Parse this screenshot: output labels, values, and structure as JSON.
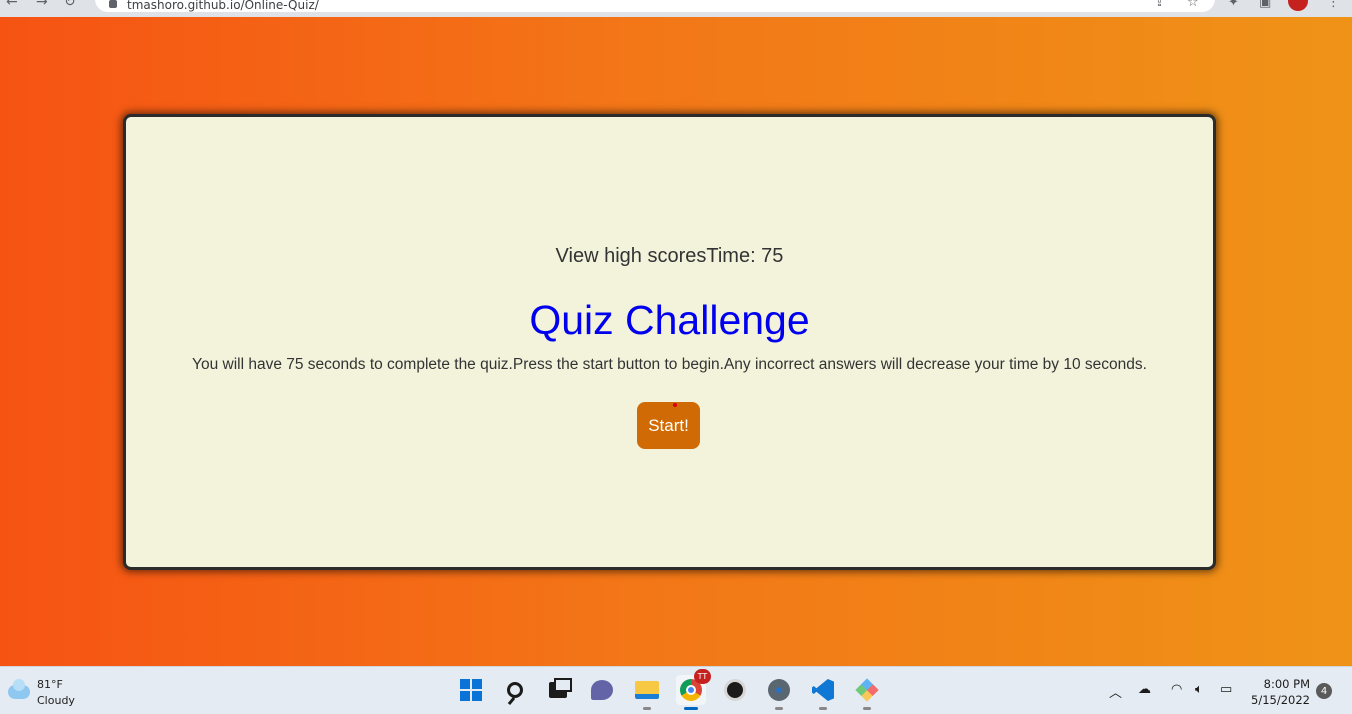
{
  "browser": {
    "url": "tmashoro.github.io/Online-Quiz/"
  },
  "page": {
    "header_text": "View high scoresTime: 75",
    "title": "Quiz Challenge",
    "instructions": "You will have 75 seconds to complete the quiz.Press the start button to begin.Any incorrect answers will decrease your time by 10 seconds.",
    "start_button_label": "Start!",
    "colors": {
      "background_gradient_start": "#f65313",
      "background_gradient_end": "#ef9317",
      "card_background": "#f3f3dc",
      "title_color": "#0000ee",
      "button_color": "#d06a04"
    }
  },
  "taskbar": {
    "weather": {
      "temperature": "81°F",
      "condition": "Cloudy",
      "icon": "cloud-icon"
    },
    "apps": [
      {
        "name": "start",
        "icon": "windows-icon"
      },
      {
        "name": "search",
        "icon": "search-icon"
      },
      {
        "name": "task-view",
        "icon": "task-view-icon"
      },
      {
        "name": "teams",
        "icon": "teams-icon"
      },
      {
        "name": "file-explorer",
        "icon": "folder-icon"
      },
      {
        "name": "chrome",
        "icon": "chrome-icon",
        "badge": "TT",
        "active": true
      },
      {
        "name": "github-desktop",
        "icon": "github-icon"
      },
      {
        "name": "settings",
        "icon": "gear-icon"
      },
      {
        "name": "vscode",
        "icon": "vscode-icon"
      },
      {
        "name": "gitkraken",
        "icon": "gitkraken-icon"
      }
    ],
    "tray": {
      "time": "8:00 PM",
      "date": "5/15/2022",
      "notification_count": "4"
    }
  }
}
